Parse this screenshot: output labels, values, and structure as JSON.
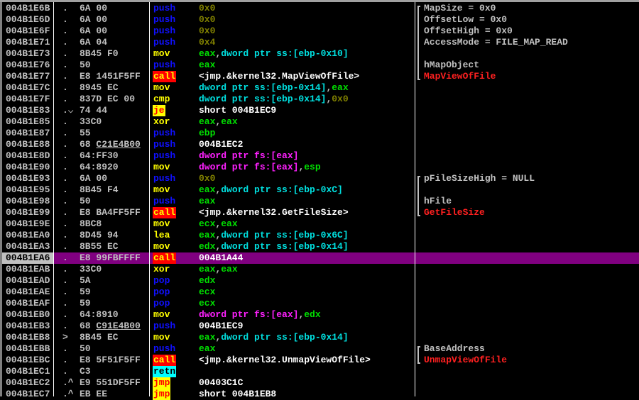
{
  "selected_index": 22,
  "colors": {
    "selection": "#800080",
    "call": "#ff0000",
    "jump": "#ffff00",
    "retn": "#00ffff",
    "push_pop": "#1010ff",
    "immediate": "#808000",
    "register": "#00e000",
    "memory": "#00e0e0",
    "fs_memory": "#ff20ff"
  },
  "rows": [
    {
      "addr": "004B1E6B",
      "mark": ".",
      "hex": "6A 00",
      "mn": "push",
      "mk": "push",
      "ops": [
        [
          "0x0",
          "imm"
        ]
      ],
      "cm": "MapSize = 0x0"
    },
    {
      "addr": "004B1E6D",
      "mark": ".",
      "hex": "6A 00",
      "mn": "push",
      "mk": "push",
      "ops": [
        [
          "0x0",
          "imm"
        ]
      ],
      "cm": "OffsetLow = 0x0"
    },
    {
      "addr": "004B1E6F",
      "mark": ".",
      "hex": "6A 00",
      "mn": "push",
      "mk": "push",
      "ops": [
        [
          "0x0",
          "imm"
        ]
      ],
      "cm": "OffsetHigh = 0x0"
    },
    {
      "addr": "004B1E71",
      "mark": ".",
      "hex": "6A 04",
      "mn": "push",
      "mk": "push",
      "ops": [
        [
          "0x4",
          "imm"
        ]
      ],
      "cm": "AccessMode = FILE_MAP_READ"
    },
    {
      "addr": "004B1E73",
      "mark": ".",
      "hex": "8B45 F0",
      "mn": "mov",
      "mk": "mov",
      "ops": [
        [
          "eax",
          "reg"
        ],
        [
          ",",
          "sep"
        ],
        [
          "dword ptr ss:[ebp-0x10]",
          "mem"
        ]
      ]
    },
    {
      "addr": "004B1E76",
      "mark": ".",
      "hex": "50",
      "mn": "push",
      "mk": "push",
      "ops": [
        [
          "eax",
          "reg"
        ]
      ],
      "cm": "hMapObject"
    },
    {
      "addr": "004B1E77",
      "mark": ".",
      "hex": "E8 1451F5FF",
      "mn": "call",
      "mk": "call",
      "ops": [
        [
          "<jmp.&kernel32.MapViewOfFile>",
          "txt"
        ]
      ],
      "cm": "MapViewOfFile",
      "cmred": true
    },
    {
      "addr": "004B1E7C",
      "mark": ".",
      "hex": "8945 EC",
      "mn": "mov",
      "mk": "mov",
      "ops": [
        [
          "dword ptr ss:[ebp-0x14]",
          "mem"
        ],
        [
          ",",
          "sep"
        ],
        [
          "eax",
          "reg"
        ]
      ]
    },
    {
      "addr": "004B1E7F",
      "mark": ".",
      "hex": "837D EC 00",
      "mn": "cmp",
      "mk": "mov",
      "ops": [
        [
          "dword ptr ss:[ebp-0x14]",
          "mem"
        ],
        [
          ",",
          "sep"
        ],
        [
          "0x0",
          "imm"
        ]
      ]
    },
    {
      "addr": "004B1E83",
      "mark": ".⌵",
      "hex": "74 44",
      "mn": "je",
      "mk": "jmp",
      "ops": [
        [
          "short 004B1EC9",
          "txt"
        ]
      ]
    },
    {
      "addr": "004B1E85",
      "mark": ".",
      "hex": "33C0",
      "mn": "xor",
      "mk": "mov",
      "ops": [
        [
          "eax",
          "reg"
        ],
        [
          ",",
          "sep"
        ],
        [
          "eax",
          "reg"
        ]
      ]
    },
    {
      "addr": "004B1E87",
      "mark": ".",
      "hex": "55",
      "mn": "push",
      "mk": "push",
      "ops": [
        [
          "ebp",
          "reg"
        ]
      ]
    },
    {
      "addr": "004B1E88",
      "mark": ".",
      "hex": "68 ",
      "hexu": "C21E4B00",
      "mn": "push",
      "mk": "push",
      "ops": [
        [
          "004B1EC2",
          "txt"
        ]
      ]
    },
    {
      "addr": "004B1E8D",
      "mark": ".",
      "hex": "64:FF30",
      "mn": "push",
      "mk": "push",
      "ops": [
        [
          "dword ptr fs:[eax]",
          "fs"
        ]
      ]
    },
    {
      "addr": "004B1E90",
      "mark": ".",
      "hex": "64:8920",
      "mn": "mov",
      "mk": "mov",
      "ops": [
        [
          "dword ptr fs:[eax]",
          "fs"
        ],
        [
          ",",
          "sep"
        ],
        [
          "esp",
          "reg"
        ]
      ]
    },
    {
      "addr": "004B1E93",
      "mark": ".",
      "hex": "6A 00",
      "mn": "push",
      "mk": "push",
      "ops": [
        [
          "0x0",
          "imm"
        ]
      ],
      "cm": "pFileSizeHigh = NULL"
    },
    {
      "addr": "004B1E95",
      "mark": ".",
      "hex": "8B45 F4",
      "mn": "mov",
      "mk": "mov",
      "ops": [
        [
          "eax",
          "reg"
        ],
        [
          ",",
          "sep"
        ],
        [
          "dword ptr ss:[ebp-0xC]",
          "mem"
        ]
      ]
    },
    {
      "addr": "004B1E98",
      "mark": ".",
      "hex": "50",
      "mn": "push",
      "mk": "push",
      "ops": [
        [
          "eax",
          "reg"
        ]
      ],
      "cm": "hFile"
    },
    {
      "addr": "004B1E99",
      "mark": ".",
      "hex": "E8 BA4FF5FF",
      "mn": "call",
      "mk": "call",
      "ops": [
        [
          "<jmp.&kernel32.GetFileSize>",
          "txt"
        ]
      ],
      "cm": "GetFileSize",
      "cmred": true
    },
    {
      "addr": "004B1E9E",
      "mark": ".",
      "hex": "8BC8",
      "mn": "mov",
      "mk": "mov",
      "ops": [
        [
          "ecx",
          "reg"
        ],
        [
          ",",
          "sep"
        ],
        [
          "eax",
          "reg"
        ]
      ]
    },
    {
      "addr": "004B1EA0",
      "mark": ".",
      "hex": "8D45 94",
      "mn": "lea",
      "mk": "mov",
      "ops": [
        [
          "eax",
          "reg"
        ],
        [
          ",",
          "sep"
        ],
        [
          "dword ptr ss:[ebp-0x6C]",
          "mem"
        ]
      ]
    },
    {
      "addr": "004B1EA3",
      "mark": ".",
      "hex": "8B55 EC",
      "mn": "mov",
      "mk": "mov",
      "ops": [
        [
          "edx",
          "reg"
        ],
        [
          ",",
          "sep"
        ],
        [
          "dword ptr ss:[ebp-0x14]",
          "mem"
        ]
      ]
    },
    {
      "addr": "004B1EA6",
      "mark": ".",
      "hex": "E8 99FBFFFF",
      "mn": "call",
      "mk": "call",
      "ops": [
        [
          "004B1A44",
          "txt"
        ]
      ]
    },
    {
      "addr": "004B1EAB",
      "mark": ".",
      "hex": "33C0",
      "mn": "xor",
      "mk": "mov",
      "ops": [
        [
          "eax",
          "reg"
        ],
        [
          ",",
          "sep"
        ],
        [
          "eax",
          "reg"
        ]
      ]
    },
    {
      "addr": "004B1EAD",
      "mark": ".",
      "hex": "5A",
      "mn": "pop",
      "mk": "push",
      "ops": [
        [
          "edx",
          "reg"
        ]
      ]
    },
    {
      "addr": "004B1EAE",
      "mark": ".",
      "hex": "59",
      "mn": "pop",
      "mk": "push",
      "ops": [
        [
          "ecx",
          "reg"
        ]
      ]
    },
    {
      "addr": "004B1EAF",
      "mark": ".",
      "hex": "59",
      "mn": "pop",
      "mk": "push",
      "ops": [
        [
          "ecx",
          "reg"
        ]
      ]
    },
    {
      "addr": "004B1EB0",
      "mark": ".",
      "hex": "64:8910",
      "mn": "mov",
      "mk": "mov",
      "ops": [
        [
          "dword ptr fs:[eax]",
          "fs"
        ],
        [
          ",",
          "sep"
        ],
        [
          "edx",
          "reg"
        ]
      ]
    },
    {
      "addr": "004B1EB3",
      "mark": ".",
      "hex": "68 ",
      "hexu": "C91E4B00",
      "mn": "push",
      "mk": "push",
      "ops": [
        [
          "004B1EC9",
          "txt"
        ]
      ]
    },
    {
      "addr": "004B1EB8",
      "mark": ">",
      "hex": "8B45 EC",
      "mn": "mov",
      "mk": "mov",
      "ops": [
        [
          "eax",
          "reg"
        ],
        [
          ",",
          "sep"
        ],
        [
          "dword ptr ss:[ebp-0x14]",
          "mem"
        ]
      ]
    },
    {
      "addr": "004B1EBB",
      "mark": ".",
      "hex": "50",
      "mn": "push",
      "mk": "push",
      "ops": [
        [
          "eax",
          "reg"
        ]
      ],
      "cm": "BaseAddress"
    },
    {
      "addr": "004B1EBC",
      "mark": ".",
      "hex": "E8 5F51F5FF",
      "mn": "call",
      "mk": "call",
      "ops": [
        [
          "<jmp.&kernel32.UnmapViewOfFile>",
          "txt"
        ]
      ],
      "cm": "UnmapViewOfFile",
      "cmred": true
    },
    {
      "addr": "004B1EC1",
      "mark": ".",
      "hex": "C3",
      "mn": "retn",
      "mk": "retn",
      "ops": []
    },
    {
      "addr": "004B1EC2",
      "mark": ".^",
      "hex": "E9 551DF5FF",
      "mn": "jmp",
      "mk": "jmp",
      "ops": [
        [
          "00403C1C",
          "txt"
        ]
      ]
    },
    {
      "addr": "004B1EC7",
      "mark": ".^",
      "hex": "EB EE",
      "mn": "jmp",
      "mk": "jmp",
      "ops": [
        [
          "short 004B1EB8",
          "txt"
        ]
      ]
    }
  ]
}
